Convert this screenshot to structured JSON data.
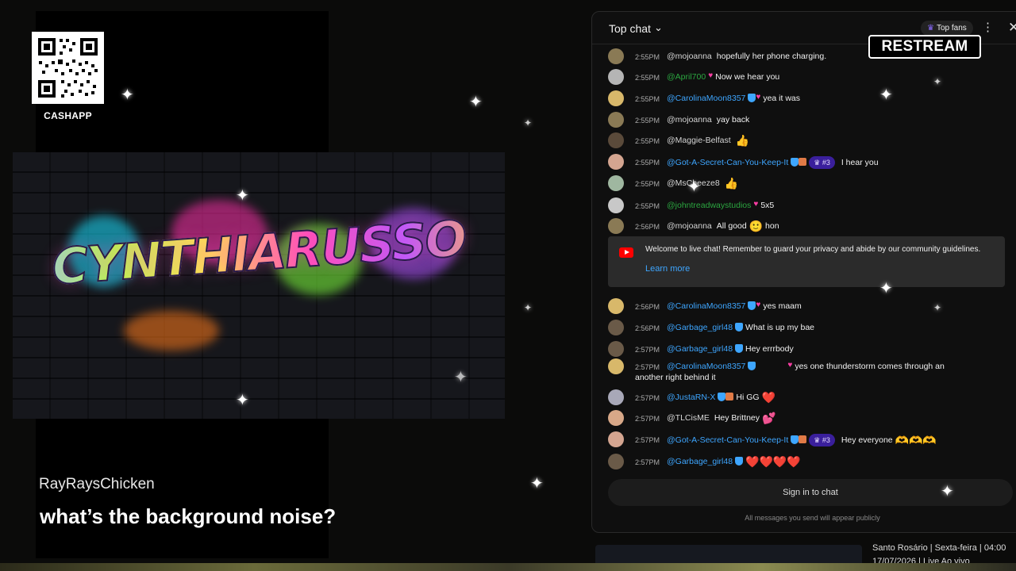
{
  "qr": {
    "label": "CASHAPP"
  },
  "banner": {
    "title": "CYNTHIARUSSO"
  },
  "comment": {
    "user": "RayRaysChicken",
    "text": "what’s the background noise?"
  },
  "chat": {
    "title": "Top chat",
    "top_fans_label": "Top fans",
    "messages": [
      {
        "time": "2:55PM",
        "author": "@mojoanna",
        "text": "hopefully her phone charging.",
        "emoji": ""
      },
      {
        "time": "2:55PM",
        "author": "@April700",
        "text": "Now we hear you",
        "emoji": ""
      },
      {
        "time": "2:55PM",
        "author": "@CarolinaMoon8357",
        "text": "yea it was",
        "emoji": ""
      },
      {
        "time": "2:55PM",
        "author": "@mojoanna",
        "text": "yay back",
        "emoji": ""
      },
      {
        "time": "2:55PM",
        "author": "@Maggie-Belfast",
        "text": "",
        "emoji": "👍"
      },
      {
        "time": "2:55PM",
        "author": "@Got-A-Secret-Can-You-Keep-It",
        "rank": "#3",
        "text": "I hear you",
        "emoji": ""
      },
      {
        "time": "2:55PM",
        "author": "@MsCheeze8",
        "text": "",
        "emoji": "👍"
      },
      {
        "time": "2:55PM",
        "author": "@johntreadwaystudios",
        "text": "5x5",
        "emoji": ""
      },
      {
        "time": "2:56PM",
        "author": "@mojoanna",
        "text": "All good",
        "emoji": "🙂",
        "after": "hon"
      },
      {
        "time": "2:56PM",
        "author": "@CarolinaMoon8357",
        "text": "yes maam",
        "emoji": ""
      },
      {
        "time": "2:56PM",
        "author": "@Garbage_girl48",
        "text": "What is up my bae",
        "emoji": ""
      },
      {
        "time": "2:57PM",
        "author": "@Garbage_girl48",
        "text": "Hey errrbody",
        "emoji": ""
      },
      {
        "time": "2:57PM",
        "author": "@CarolinaMoon8357",
        "text": "yes one thunderstorm comes through an another right behind it",
        "emoji": ""
      },
      {
        "time": "2:57PM",
        "author": "@JustaRN-X",
        "text": "Hi GG",
        "emoji": "❤️"
      },
      {
        "time": "2:57PM",
        "author": "@TLCisME",
        "text": "Hey Brittney",
        "emoji": "💕"
      },
      {
        "time": "2:57PM",
        "author": "@Got-A-Secret-Can-You-Keep-It",
        "rank": "#3",
        "text": "Hey everyone",
        "emoji": "🫶🫶🫶"
      },
      {
        "time": "2:57PM",
        "author": "@Garbage_girl48",
        "text": "",
        "emoji": "❤️❤️❤️❤️"
      }
    ],
    "welcome_text": "Welcome to live chat! Remember to guard your privacy and abide by our community guidelines.",
    "learn_more": "Learn more",
    "sign_in": "Sign in to chat",
    "footnote": "All messages you send will appear publicly"
  },
  "brand": {
    "restream": "RESTREAM"
  },
  "next_video": {
    "line1": "Santo Rosário | Sexta-feira | 04:00",
    "line2": "17/07/2026 | Live Ao vivo"
  }
}
